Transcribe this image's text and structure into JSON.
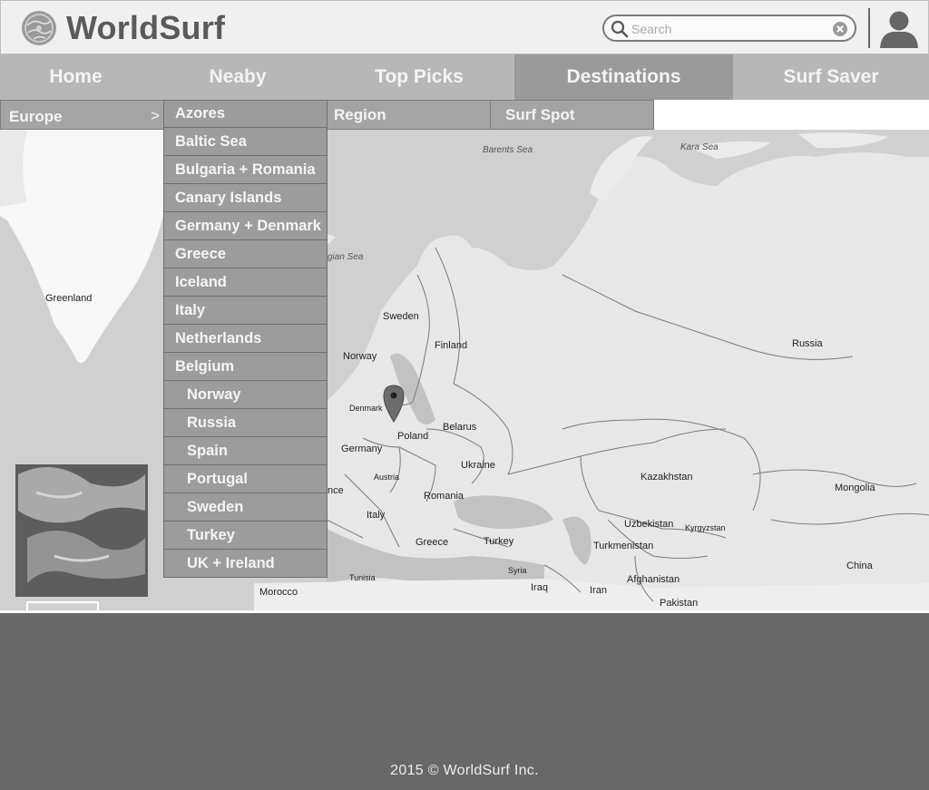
{
  "brand": {
    "name": "WorldSurf"
  },
  "search": {
    "placeholder": "Search"
  },
  "nav": {
    "items": [
      "Home",
      "Neaby",
      "Top Picks",
      "Destinations",
      "Surf Saver"
    ],
    "active": "Destinations"
  },
  "subnav": {
    "region_label": "Europe",
    "region_arrow": ">",
    "region_header": "Region",
    "spot_header": "Surf Spot"
  },
  "dropdown": {
    "items": [
      "Azores",
      "Baltic Sea",
      "Bulgaria + Romania",
      "Canary Islands",
      "Germany + Denmark",
      "Greece",
      "Iceland",
      "Italy",
      "Netherlands",
      "Belgium",
      "Norway",
      "Russia",
      "Spain",
      "Portugal",
      "Sweden",
      "Turkey",
      "UK + Ireland"
    ]
  },
  "map": {
    "labels": {
      "barents_sea": "Barents Sea",
      "kara_sea": "Kara Sea",
      "norwegian_sea": "gian Sea",
      "greenland": "Greenland",
      "sweden": "Sweden",
      "finland": "Finland",
      "norway": "Norway",
      "russia": "Russia",
      "denmark": "Denmark",
      "belarus": "Belarus",
      "poland": "Poland",
      "germany": "Germany",
      "ukraine": "Ukraine",
      "austria": "Austria",
      "france": "nce",
      "romania": "Romania",
      "kazakhstan": "Kazakhstan",
      "mongolia": "Mongolia",
      "italy": "Italy",
      "uzbekistan": "Uzbekistan",
      "kyrgyzstan": "Kyrgyzstan",
      "greece": "Greece",
      "turkey": "Turkey",
      "turkmenistan": "Turkmenistan",
      "tunisia": "Tunisia",
      "syria": "Syria",
      "china": "China",
      "afghanistan": "Afghanistan",
      "iraq": "Iraq",
      "iran": "Iran",
      "morocco": "Morocco",
      "pakistan": "Pakistan"
    }
  },
  "footer": {
    "copyright": "2015 © WorldSurf Inc."
  },
  "colors": {
    "header_bg": "#f0f0f0",
    "nav_bg": "#b7b7b7",
    "nav_active_bg": "#9a9a9a",
    "dropdown_bg": "#9c9c9c",
    "footer_bg": "#686868"
  },
  "icons": {
    "logo": "globe-logo-icon",
    "search": "search-icon",
    "clear": "clear-icon",
    "avatar": "user-avatar-icon",
    "marker": "map-pin-icon"
  }
}
